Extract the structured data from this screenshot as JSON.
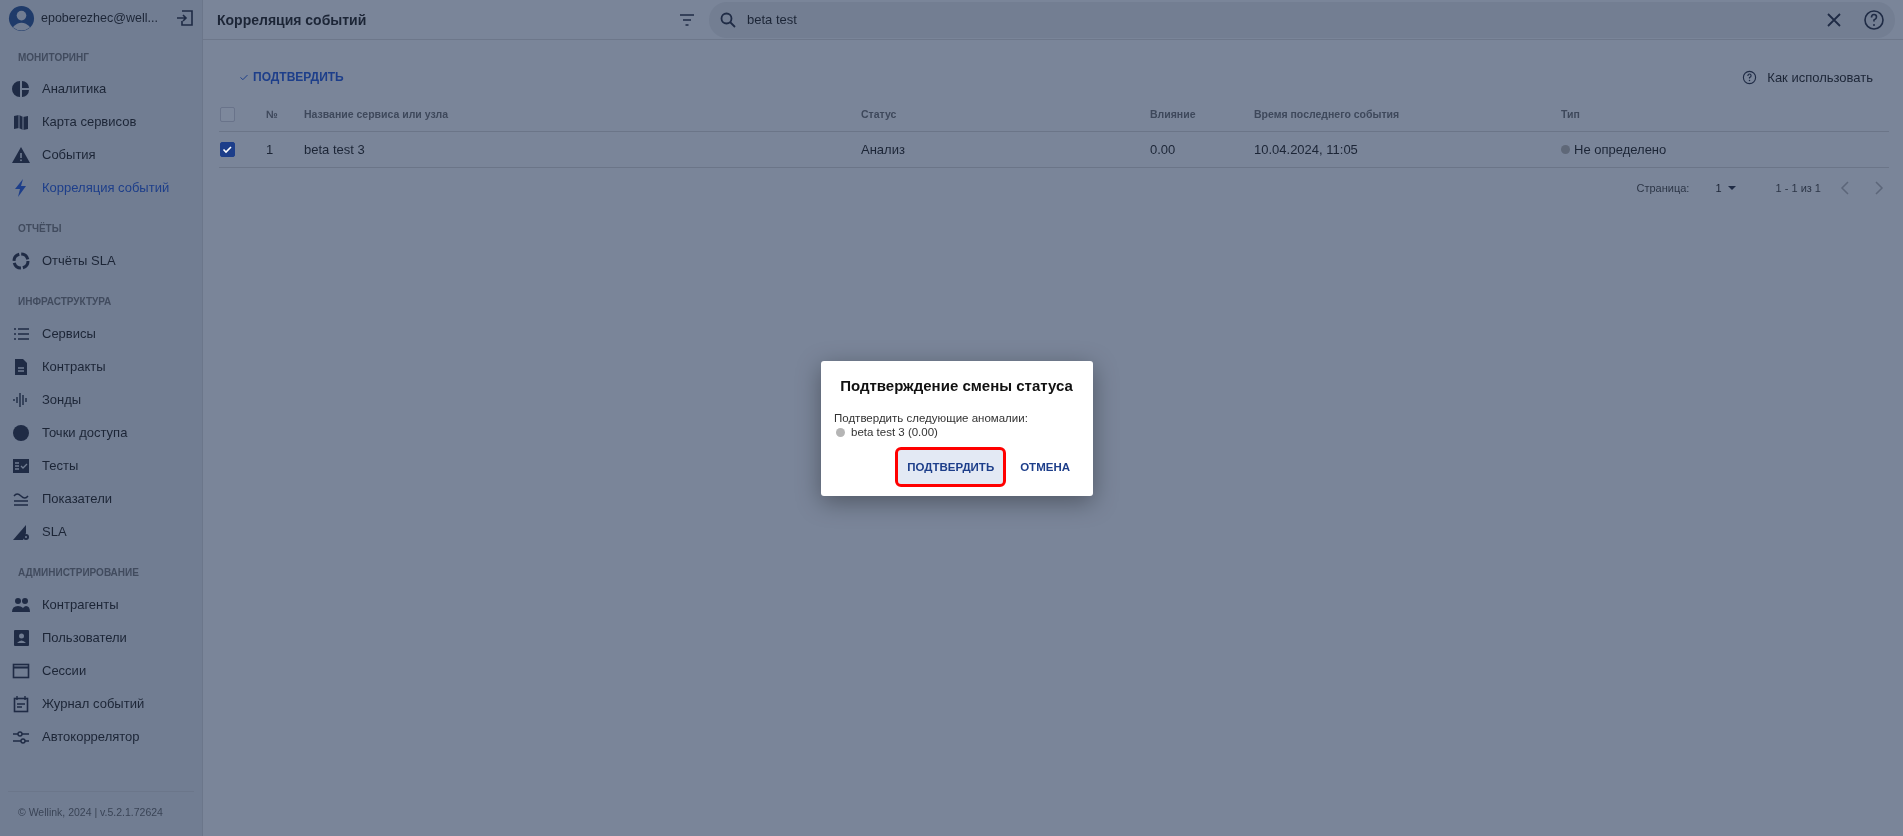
{
  "user": {
    "name": "epoberezhec@well..."
  },
  "sidebar": {
    "sections": [
      {
        "title": "МОНИТОРИНГ",
        "items": [
          {
            "label": "Аналитика",
            "selected": false
          },
          {
            "label": "Карта сервисов",
            "selected": false
          },
          {
            "label": "События",
            "selected": false
          },
          {
            "label": "Корреляция событий",
            "selected": true
          }
        ]
      },
      {
        "title": "ОТЧЁТЫ",
        "items": [
          {
            "label": "Отчёты SLA",
            "selected": false
          }
        ]
      },
      {
        "title": "ИНФРАСТРУКТУРА",
        "items": [
          {
            "label": "Сервисы",
            "selected": false
          },
          {
            "label": "Контракты",
            "selected": false
          },
          {
            "label": "Зонды",
            "selected": false
          },
          {
            "label": "Точки доступа",
            "selected": false
          },
          {
            "label": "Тесты",
            "selected": false
          },
          {
            "label": "Показатели",
            "selected": false
          },
          {
            "label": "SLA",
            "selected": false
          }
        ]
      },
      {
        "title": "АДМИНИСТРИРОВАНИЕ",
        "items": [
          {
            "label": "Контрагенты",
            "selected": false
          },
          {
            "label": "Пользователи",
            "selected": false
          },
          {
            "label": "Сессии",
            "selected": false
          },
          {
            "label": "Журнал событий",
            "selected": false
          },
          {
            "label": "Автокоррелятор",
            "selected": false
          }
        ]
      }
    ],
    "footer": "© Wellink, 2024 | v.5.2.1.72624"
  },
  "header": {
    "title": "Корреляция событий",
    "search": {
      "value": "beta test"
    }
  },
  "toolbar": {
    "confirm": "ПОДТВЕРДИТЬ",
    "help": "Как использовать"
  },
  "table": {
    "all_checked": false,
    "columns": [
      "№",
      "Название сервиса или узла",
      "Статус",
      "Влияние",
      "Время последнего события",
      "Тип"
    ],
    "rows": [
      {
        "checked": true,
        "cells": [
          "1",
          "beta test 3",
          "Анализ",
          "0.00",
          "10.04.2024, 11:05"
        ],
        "type": "Не определено",
        "color": "#5f6878"
      }
    ]
  },
  "pagination": {
    "label": "Страница:",
    "page": "1",
    "range": "1 - 1 из 1"
  },
  "dialog": {
    "title": "Подтверждение смены статуса",
    "text": "Подтвердить следующие аномалии:",
    "items": [
      {
        "label": "beta test 3 (0.00)",
        "color": "#b5b5b5"
      }
    ],
    "buttons": [
      {
        "label": "ПОДТВЕРДИТЬ",
        "kind": "primary",
        "highlighted": true
      },
      {
        "label": "ОТМЕНА",
        "kind": "text",
        "highlighted": false
      }
    ]
  }
}
